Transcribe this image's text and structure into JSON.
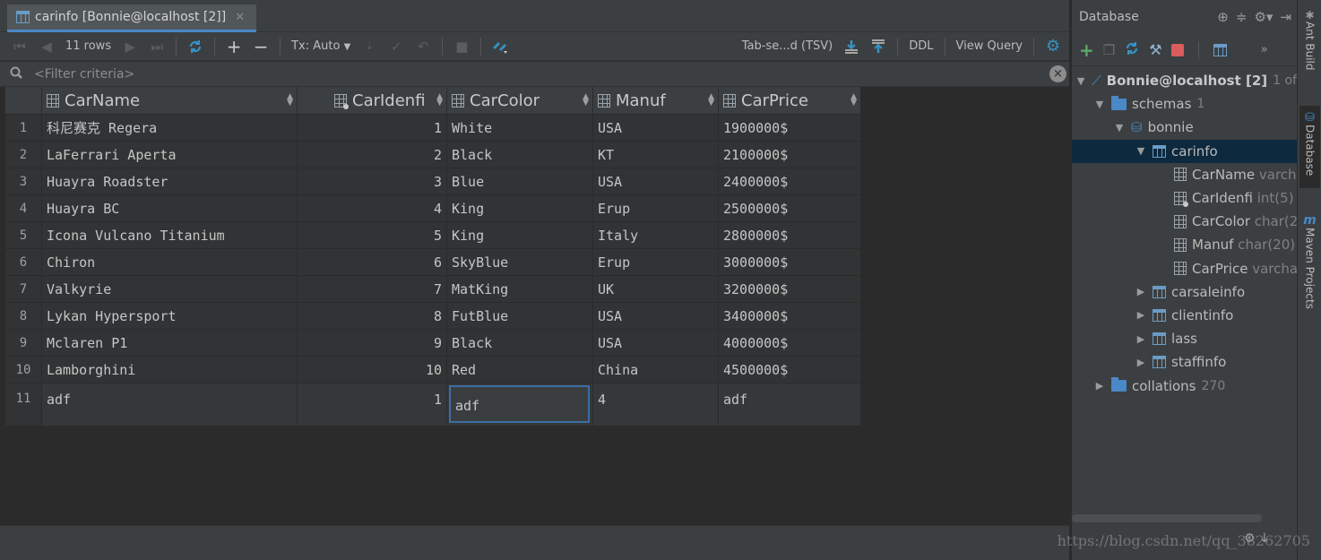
{
  "editor_tab": {
    "title": "carinfo [Bonnie@localhost [2]]"
  },
  "toolbar": {
    "rows_label": "11 rows",
    "tx_label": "Tx: Auto",
    "export_format": "Tab-se...d (TSV)",
    "ddl_label": "DDL",
    "view_query_label": "View Query"
  },
  "filter": {
    "placeholder": "<Filter criteria>"
  },
  "table": {
    "columns": [
      "CarName",
      "CarIdenfi",
      "CarColor",
      "Manuf",
      "CarPrice"
    ],
    "rows": [
      {
        "num": "1",
        "CarName": "科尼赛克 Regera",
        "CarIdenfi": "1",
        "CarColor": "White",
        "Manuf": "USA",
        "CarPrice": "1900000$"
      },
      {
        "num": "2",
        "CarName": "LaFerrari Aperta",
        "CarIdenfi": "2",
        "CarColor": "Black",
        "Manuf": "KT",
        "CarPrice": "2100000$"
      },
      {
        "num": "3",
        "CarName": "Huayra Roadster",
        "CarIdenfi": "3",
        "CarColor": "Blue",
        "Manuf": "USA",
        "CarPrice": "2400000$"
      },
      {
        "num": "4",
        "CarName": "Huayra BC",
        "CarIdenfi": "4",
        "CarColor": "King",
        "Manuf": "Erup",
        "CarPrice": "2500000$"
      },
      {
        "num": "5",
        "CarName": "Icona Vulcano Titanium",
        "CarIdenfi": "5",
        "CarColor": "King",
        "Manuf": "Italy",
        "CarPrice": "2800000$"
      },
      {
        "num": "6",
        "CarName": "Chiron",
        "CarIdenfi": "6",
        "CarColor": "SkyBlue",
        "Manuf": "Erup",
        "CarPrice": "3000000$"
      },
      {
        "num": "7",
        "CarName": "Valkyrie",
        "CarIdenfi": "7",
        "CarColor": "MatKing",
        "Manuf": "UK",
        "CarPrice": "3200000$"
      },
      {
        "num": "8",
        "CarName": "Lykan Hypersport",
        "CarIdenfi": "8",
        "CarColor": "FutBlue",
        "Manuf": "USA",
        "CarPrice": "3400000$"
      },
      {
        "num": "9",
        "CarName": "Mclaren P1",
        "CarIdenfi": "9",
        "CarColor": "Black",
        "Manuf": "USA",
        "CarPrice": "4000000$"
      },
      {
        "num": "10",
        "CarName": "Lamborghini",
        "CarIdenfi": "10",
        "CarColor": "Red",
        "Manuf": "China",
        "CarPrice": "4500000$"
      }
    ],
    "new_row": {
      "num": "11",
      "CarName": "adf",
      "CarIdenfi": "1",
      "CarColor": "adf",
      "Manuf": "4",
      "CarPrice": "adf"
    }
  },
  "db_panel": {
    "title": "Database",
    "connection": "Bonnie@localhost [2]",
    "connection_meta": "1 of",
    "schemas_label": "schemas",
    "schemas_count": "1",
    "schema_name": "bonnie",
    "selected_table": "carinfo",
    "columns": [
      {
        "name": "CarName",
        "type": "varch"
      },
      {
        "name": "CarIdenfi",
        "type": "int(5)"
      },
      {
        "name": "CarColor",
        "type": "char(2"
      },
      {
        "name": "Manuf",
        "type": "char(20)"
      },
      {
        "name": "CarPrice",
        "type": "varcha"
      }
    ],
    "other_tables": [
      "carsaleinfo",
      "clientinfo",
      "lass",
      "staffinfo"
    ],
    "collations_label": "collations",
    "collations_count": "270"
  },
  "side_strip": {
    "ant_build": "Ant Build",
    "database": "Database",
    "maven": "Maven Projects"
  },
  "watermark": "https://blog.csdn.net/qq_38262705",
  "colors": {
    "accent": "#4a88c7",
    "selection": "#0d293e",
    "background": "#2b2b2b",
    "panel": "#3c3f41"
  }
}
